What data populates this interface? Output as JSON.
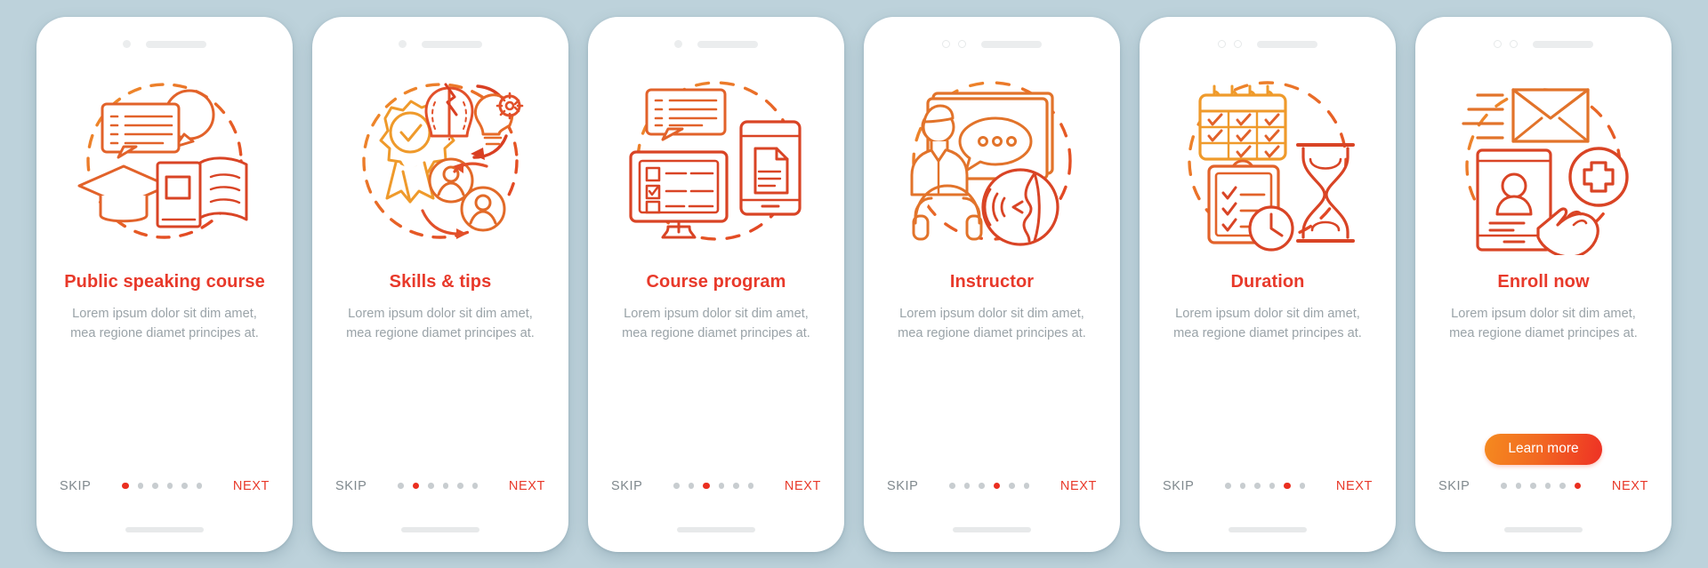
{
  "canvas": {
    "background_color": "#bdd2db",
    "accent_color": "#e8392a",
    "muted_text_color": "#9aa3a8",
    "dot_inactive_color": "#c8cdd0",
    "cta_gradient_from": "#f58a1f",
    "cta_gradient_to": "#ee3124"
  },
  "common": {
    "skip_label": "SKIP",
    "next_label": "NEXT",
    "dots_total": 6,
    "body_text": "Lorem ipsum dolor sit dim amet, mea regione diamet principes at."
  },
  "screens": [
    {
      "title": "Public speaking course",
      "description": "Lorem ipsum dolor sit dim amet, mea regione diamet principes at.",
      "skip_label": "SKIP",
      "next_label": "NEXT",
      "active_dot": 1,
      "illustration": "speech-bubbles-graduation-cap-book-icon",
      "status_style": "single-camera",
      "cta_label": null
    },
    {
      "title": "Skills & tips",
      "description": "Lorem ipsum dolor sit dim amet, mea regione diamet principes at.",
      "skip_label": "SKIP",
      "next_label": "NEXT",
      "active_dot": 2,
      "illustration": "award-brain-lightbulb-users-icon",
      "status_style": "single-camera",
      "cta_label": null
    },
    {
      "title": "Course program",
      "description": "Lorem ipsum dolor sit dim amet, mea regione diamet principes at.",
      "skip_label": "SKIP",
      "next_label": "NEXT",
      "active_dot": 3,
      "illustration": "monitor-checklist-tablet-document-icon",
      "status_style": "single-camera",
      "cta_label": null
    },
    {
      "title": "Instructor",
      "description": "Lorem ipsum dolor sit dim amet, mea regione diamet principes at.",
      "skip_label": "SKIP",
      "next_label": "NEXT",
      "active_dot": 4,
      "illustration": "teacher-whiteboard-headphones-speaking-icon",
      "status_style": "dual-camera",
      "cta_label": null
    },
    {
      "title": "Duration",
      "description": "Lorem ipsum dolor sit dim amet, mea regione diamet principes at.",
      "skip_label": "SKIP",
      "next_label": "NEXT",
      "active_dot": 5,
      "illustration": "calendar-hourglass-clipboard-clock-icon",
      "status_style": "dual-camera",
      "cta_label": null
    },
    {
      "title": "Enroll now",
      "description": "Lorem ipsum dolor sit dim amet, mea regione diamet principes at.",
      "skip_label": "SKIP",
      "next_label": "NEXT",
      "active_dot": 6,
      "illustration": "envelope-profile-card-plus-hand-icon",
      "status_style": "dual-camera",
      "cta_label": "Learn more"
    }
  ]
}
